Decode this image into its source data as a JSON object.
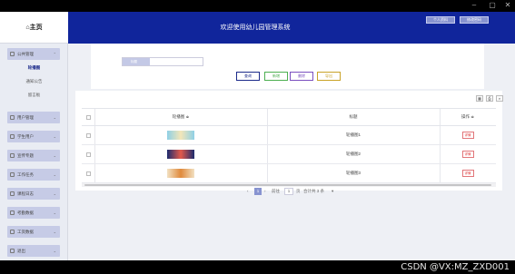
{
  "window": {
    "minimize": "–",
    "maximize": "▢",
    "close": "✕"
  },
  "sidebar": {
    "logo": "⌂主页",
    "group1": {
      "label": "公共管理",
      "items": [
        "轮播图",
        "通知公告",
        "留言板"
      ]
    },
    "groups": [
      "用户管理",
      "学生用户",
      "宣传专题",
      "工作任务",
      "课程日志",
      "考勤数据",
      "工资数据",
      "退出"
    ]
  },
  "header": {
    "title": "欢迎使用幼儿园管理系统",
    "btn1": "个人资料",
    "btn2": "修改密码"
  },
  "search": {
    "label": "标题",
    "value": ""
  },
  "actions": {
    "query": "查询",
    "add": "新增",
    "delete": "删除",
    "export": "导出"
  },
  "colors": {
    "header_bg": "#10259b",
    "query": "#1b2a8a",
    "add": "#4caf50",
    "delete": "#7a4fbf",
    "export": "#c9a227",
    "row_btn": "#d33"
  },
  "table": {
    "headers": [
      "轮播图",
      "标题",
      "操作"
    ],
    "sort_icon": "≑",
    "rows": [
      {
        "title": "轮播图1",
        "op": "详情",
        "thumb_colors": [
          "#8fd0e6",
          "#f3e6b8"
        ]
      },
      {
        "title": "轮播图2",
        "op": "详情",
        "thumb_colors": [
          "#1c2b6e",
          "#e35a4a"
        ]
      },
      {
        "title": "轮播图3",
        "op": "详情",
        "thumb_colors": [
          "#f2e1c2",
          "#e08a3c"
        ]
      }
    ]
  },
  "pager": {
    "prev": "‹",
    "page": "1",
    "next": "›",
    "goto": "前往",
    "goto_page": "1",
    "unit": "页",
    "total": "合计共 3 条",
    "dropdown": "▾"
  },
  "watermark": "CSDN @VX:MZ_ZXD001"
}
